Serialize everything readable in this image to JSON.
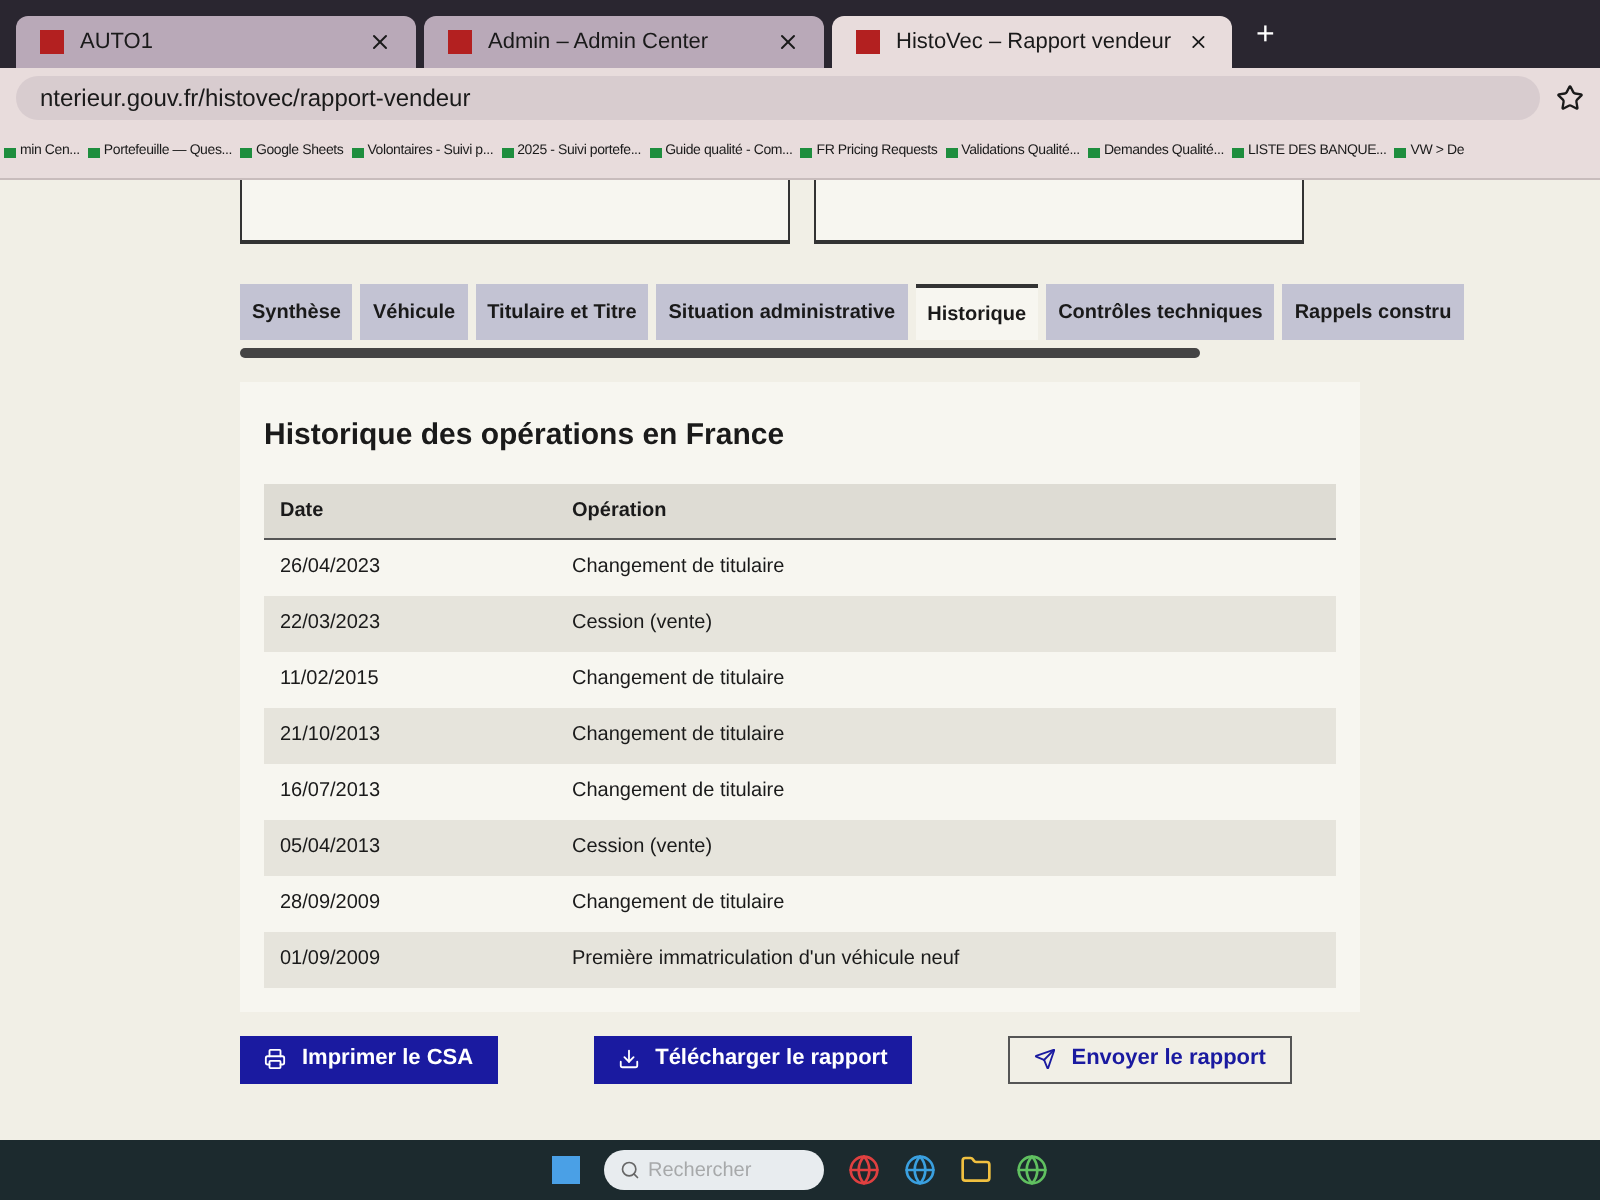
{
  "browser": {
    "tabs": [
      {
        "title": "AUTO1",
        "selected": false
      },
      {
        "title": "Admin – Admin Center",
        "selected": false
      },
      {
        "title": "HistoVec – Rapport vendeur",
        "selected": true
      }
    ],
    "new_tab": "+",
    "address": "nterieur.gouv.fr/histovec/rapport-vendeur",
    "bookmarks": [
      "min Cen...",
      "Portefeuille — Ques...",
      "Google Sheets",
      "Volontaires - Suivi p...",
      "2025 - Suivi portefe...",
      "Guide qualité - Com...",
      "FR Pricing Requests",
      "Validations Qualité...",
      "Demandes Qualité...",
      "LISTE DES BANQUE...",
      "VW > De"
    ]
  },
  "report_tabs": [
    {
      "label": "Synthèse",
      "selected": false
    },
    {
      "label": "Véhicule",
      "selected": false
    },
    {
      "label": "Titulaire et Titre",
      "selected": false
    },
    {
      "label": "Situation administrative",
      "selected": false
    },
    {
      "label": "Historique",
      "selected": true
    },
    {
      "label": "Contrôles techniques",
      "selected": false
    },
    {
      "label": "Rappels constru",
      "selected": false
    }
  ],
  "section": {
    "title": "Historique des opérations en France",
    "table": {
      "columns": [
        "Date",
        "Opération"
      ],
      "rows": [
        [
          "26/04/2023",
          "Changement de titulaire"
        ],
        [
          "22/03/2023",
          "Cession (vente)"
        ],
        [
          "11/02/2015",
          "Changement de titulaire"
        ],
        [
          "21/10/2013",
          "Changement de titulaire"
        ],
        [
          "16/07/2013",
          "Changement de titulaire"
        ],
        [
          "05/04/2013",
          "Cession (vente)"
        ],
        [
          "28/09/2009",
          "Changement de titulaire"
        ],
        [
          "01/09/2009",
          "Première immatriculation d'un véhicule neuf"
        ]
      ]
    }
  },
  "actions": [
    {
      "label": "Imprimer le CSA",
      "kind": "primary"
    },
    {
      "label": "Télécharger le rapport",
      "kind": "primary"
    },
    {
      "label": "Envoyer le rapport",
      "kind": "secondary"
    }
  ],
  "taskbar": {
    "search_placeholder": "Rechercher"
  }
}
